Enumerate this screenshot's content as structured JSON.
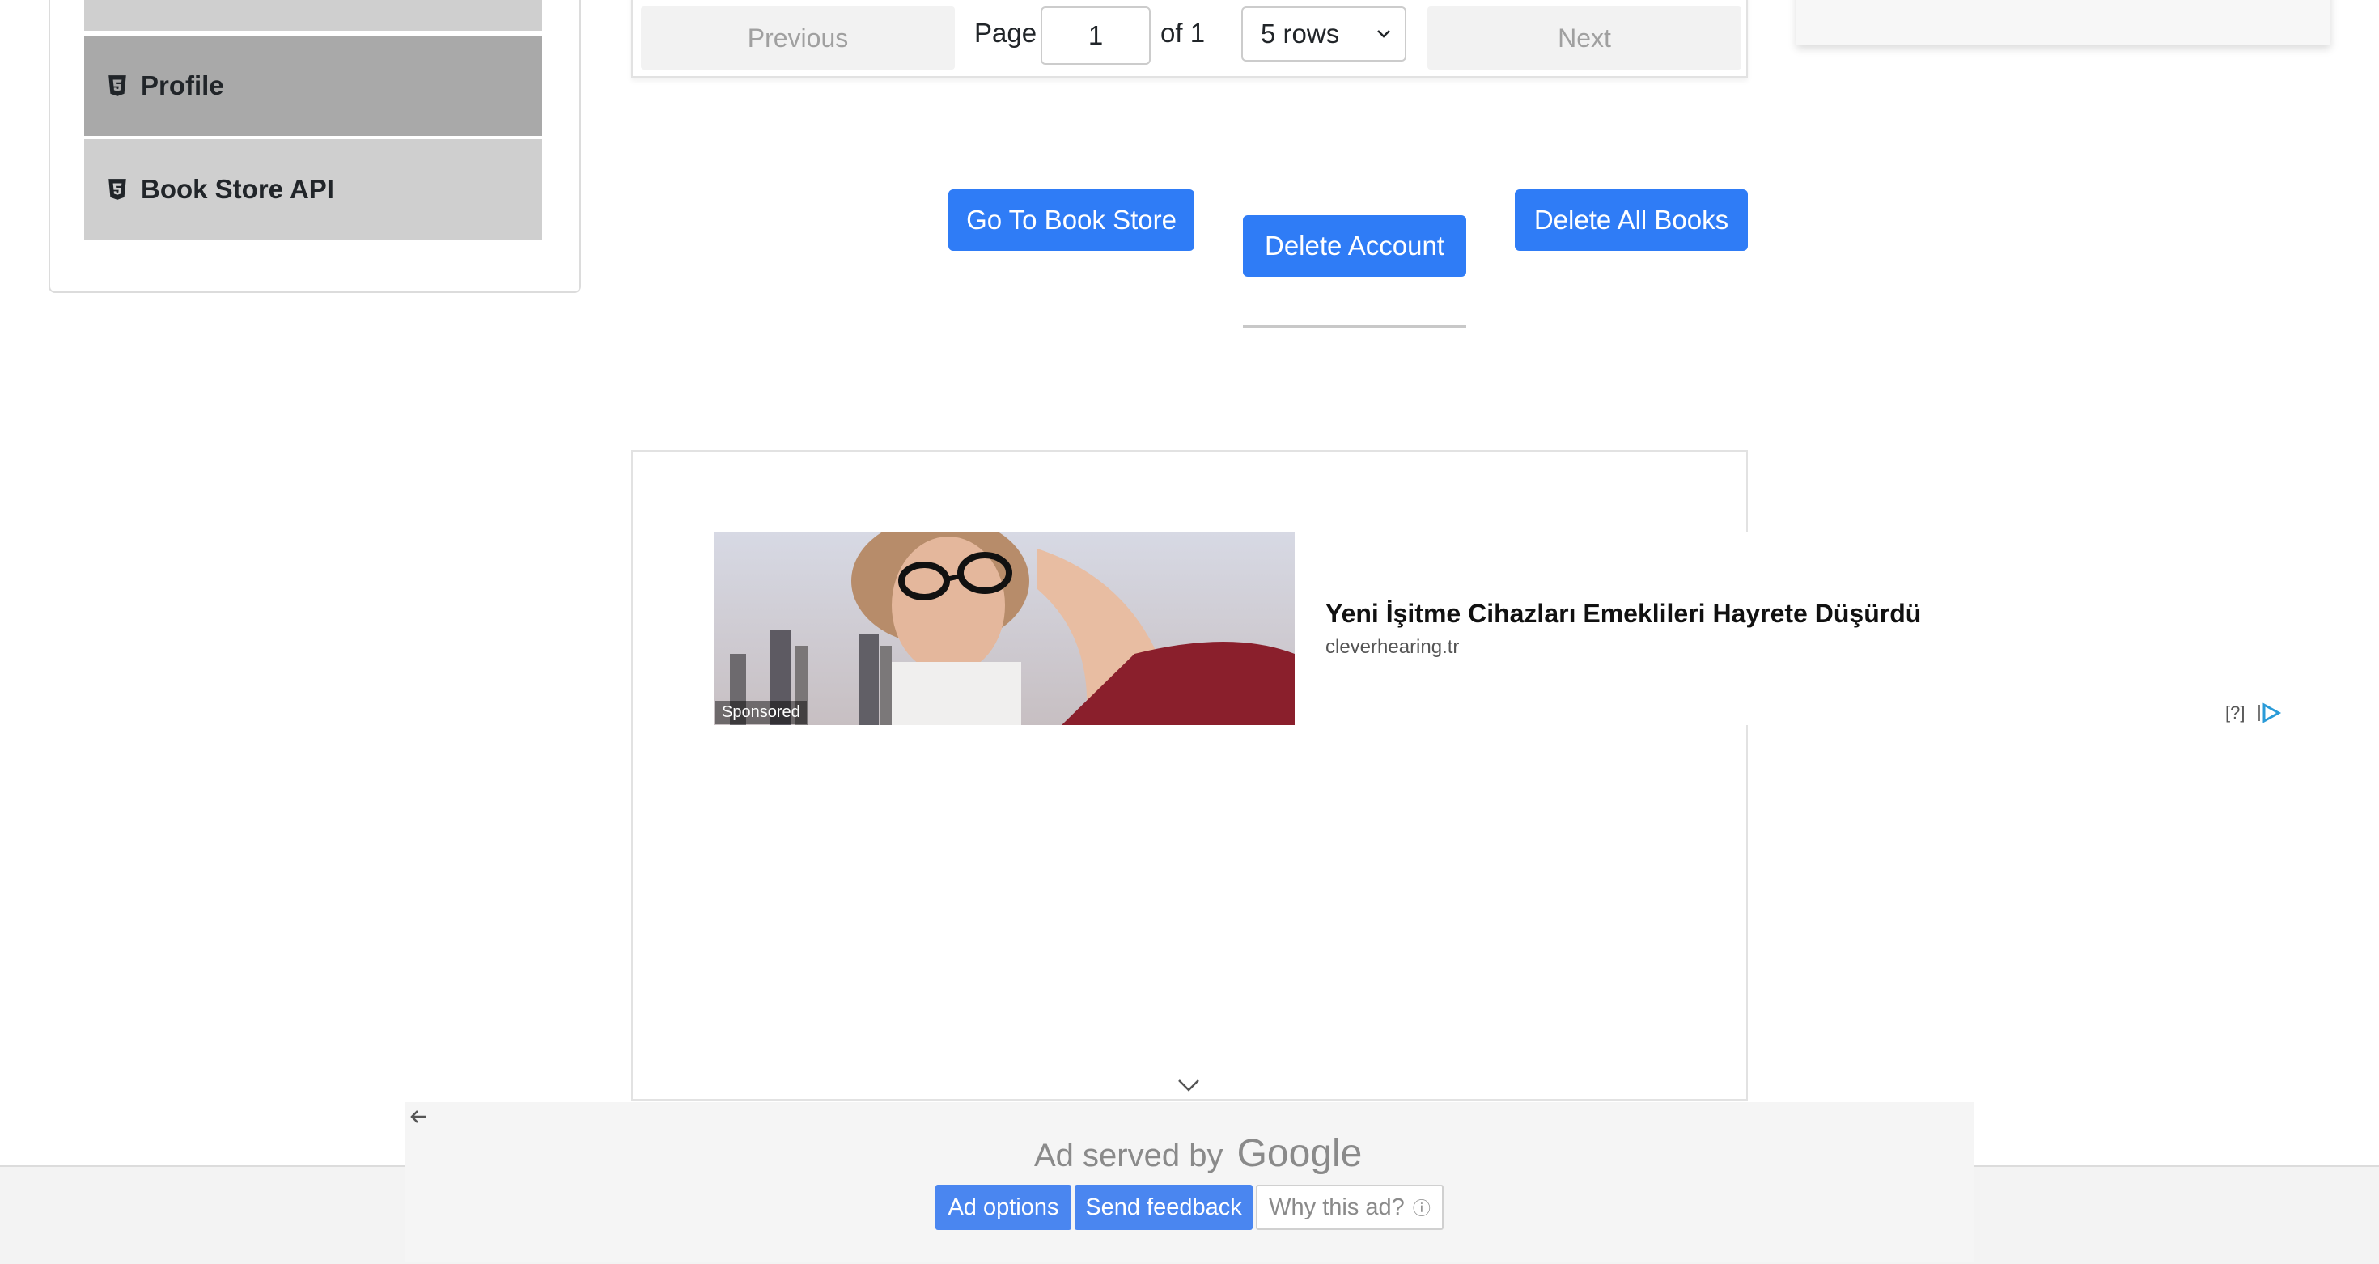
{
  "sidebar": {
    "items": [
      {
        "label": ""
      },
      {
        "label": "Profile"
      },
      {
        "label": "Book Store API"
      }
    ]
  },
  "pagination": {
    "previous_label": "Previous",
    "page_label": "Page",
    "page_value": "1",
    "of_label": "of 1",
    "rows_selected": "5 rows",
    "next_label": "Next"
  },
  "actions": {
    "go_to_store": "Go To Book Store",
    "delete_account": "Delete Account",
    "delete_all_books": "Delete All Books"
  },
  "ad": {
    "sponsored": "Sponsored",
    "headline": "Yeni İşitme Cihazları Emeklileri Hayrete Düşürdü",
    "domain": "cleverhearing.tr",
    "help": "[?]",
    "served_by": "Ad served by",
    "google": "Google",
    "options_label": "Ad options",
    "feedback_label": "Send feedback",
    "why_label": "Why this ad?",
    "why_icon": "ⓘ"
  },
  "colors": {
    "primary_button": "#2f7cf6",
    "ad_button": "#4a86f0",
    "menu_active": "#a9a9a9",
    "menu_item": "#cfcfcf"
  }
}
